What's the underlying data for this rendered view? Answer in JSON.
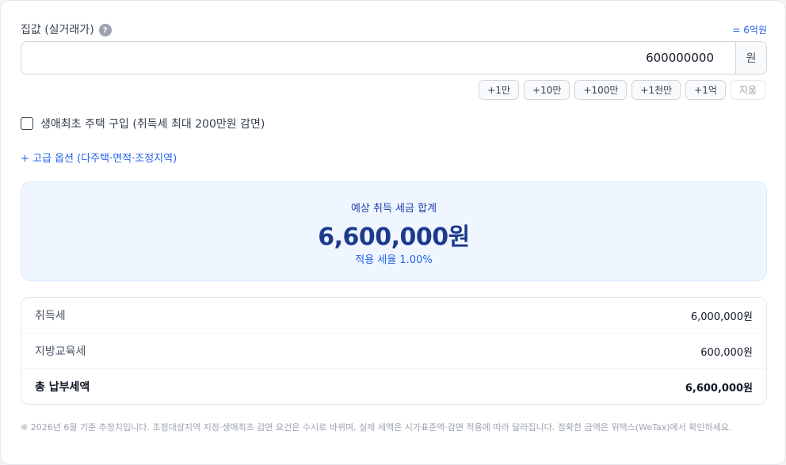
{
  "price_field": {
    "label": "집값 (실거래가)",
    "help_icon": "question-mark-icon",
    "help_glyph": "?",
    "converted_hint": "= 6억원",
    "value": "600000000",
    "unit": "원"
  },
  "quick_buttons": [
    {
      "label": "+1만"
    },
    {
      "label": "+10만"
    },
    {
      "label": "+100만"
    },
    {
      "label": "+1천만"
    },
    {
      "label": "+1억"
    },
    {
      "label": "지움"
    }
  ],
  "first_home": {
    "label": "생애최초 주택 구입 (취득세 최대 200만원 감면)",
    "checked": false
  },
  "advanced_options": {
    "label": "+ 고급 옵션 (다주택·면적·조정지역)"
  },
  "summary": {
    "title": "예상 취득 세금 합계",
    "amount": "6,600,000원",
    "rate": "적용 세율 1.00%"
  },
  "breakdown": [
    {
      "label": "취득세",
      "value": "6,000,000원"
    },
    {
      "label": "지방교육세",
      "value": "600,000원"
    },
    {
      "label": "총 납부세액",
      "value": "6,600,000원"
    }
  ],
  "disclaimer": "※ 2026년 6월 기준 추정치입니다. 조정대상지역 지정·생애최초 감면 요건은 수시로 바뀌며, 실제 세액은 시가표준액·감면 적용에 따라 달라집니다. 정확한 금액은 위택스(WeTax)에서 확인하세요.",
  "colors": {
    "accent": "#2563eb",
    "summary_bg": "#eff6ff",
    "summary_amount": "#1e3a8a"
  }
}
